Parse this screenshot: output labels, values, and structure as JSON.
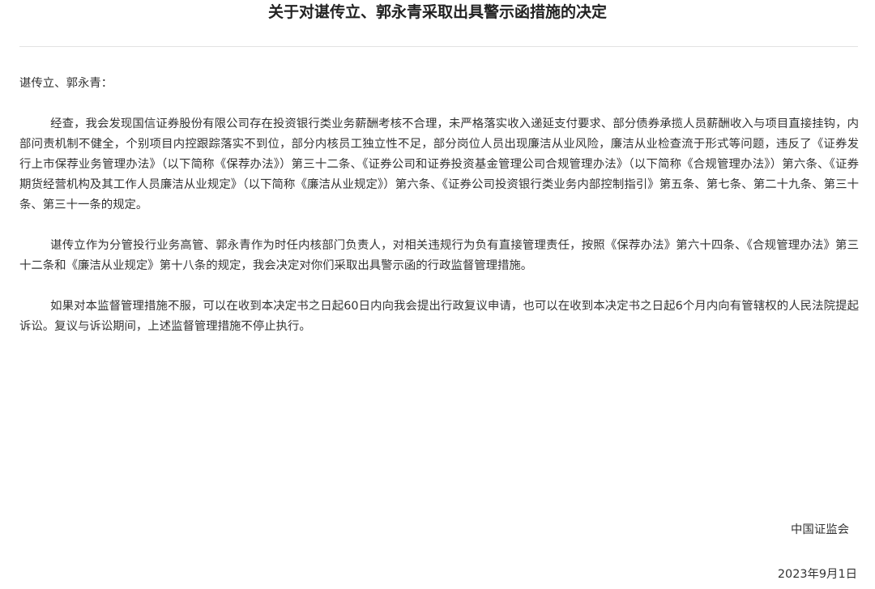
{
  "document": {
    "title": "关于对谌传立、郭永青采取出具警示函措施的决定",
    "salutation": "谌传立、郭永青：",
    "paragraphs": [
      "经查，我会发现国信证券股份有限公司存在投资银行类业务薪酬考核不合理，未严格落实收入递延支付要求、部分债券承揽人员薪酬收入与项目直接挂钩，内部问责机制不健全，个别项目内控跟踪落实不到位，部分内核员工独立性不足，部分岗位人员出现廉洁从业风险，廉洁从业检查流于形式等问题，违反了《证券发行上市保荐业务管理办法》（以下简称《保荐办法》）第三十二条、《证券公司和证券投资基金管理公司合规管理办法》（以下简称《合规管理办法》）第六条、《证券期货经营机构及其工作人员廉洁从业规定》（以下简称《廉洁从业规定》）第六条、《证券公司投资银行类业务内部控制指引》第五条、第七条、第二十九条、第三十条、第三十一条的规定。",
      "谌传立作为分管投行业务高管、郭永青作为时任内核部门负责人，对相关违规行为负有直接管理责任，按照《保荐办法》第六十四条、《合规管理办法》第三十二条和《廉洁从业规定》第十八条的规定，我会决定对你们采取出具警示函的行政监督管理措施。",
      "如果对本监督管理措施不服，可以在收到本决定书之日起60日内向我会提出行政复议申请，也可以在收到本决定书之日起6个月内向有管辖权的人民法院提起诉讼。复议与诉讼期间，上述监督管理措施不停止执行。"
    ],
    "signature": "中国证监会",
    "date": "2023年9月1日"
  }
}
